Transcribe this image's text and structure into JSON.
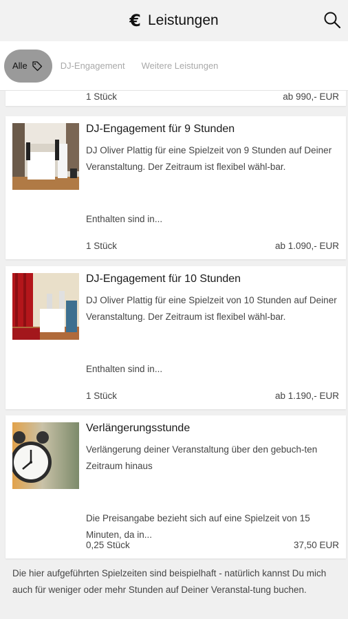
{
  "header": {
    "title": "Leistungen",
    "icon": "euro-icon",
    "icon_glyph": "€",
    "search_icon": "search-icon"
  },
  "filters": {
    "all": "Alle",
    "tag_icon": "tag-icon",
    "items": [
      "DJ-Engagement",
      "Weitere Leistungen"
    ]
  },
  "partial": {
    "qty": "1 Stück",
    "price": "ab 990,- EUR"
  },
  "cards": [
    {
      "title": "DJ-Engagement für 9 Stunden",
      "desc": "DJ Oliver Plattig für eine Spielzeit von 9 Stunden auf Deiner Veranstaltung. Der Zeitraum ist flexibel wähl-bar.",
      "more": "Enthalten sind in...",
      "qty": "1 Stück",
      "price": "ab 1.090,- EUR"
    },
    {
      "title": "DJ-Engagement für 10 Stunden",
      "desc": "DJ Oliver Plattig für eine Spielzeit von 10 Stunden auf Deiner Veranstaltung. Der Zeitraum ist flexibel wähl-bar.",
      "more": "Enthalten sind in...",
      "qty": "1 Stück",
      "price": "ab 1.190,- EUR"
    },
    {
      "title": "Verlängerungsstunde",
      "desc": "Verlängerung deiner Veranstaltung über den gebuch-ten Zeitraum hinaus",
      "more": "Die Preisangabe bezieht sich auf eine Spielzeit von 15 Minuten, da in...",
      "qty": "0,25 Stück",
      "price": "37,50 EUR"
    }
  ],
  "footer": {
    "note": "Die hier aufgeführten Spielzeiten sind beispielhaft - natürlich kannst Du mich auch für weniger oder mehr Stunden auf Deiner Veranstal-tung buchen."
  }
}
